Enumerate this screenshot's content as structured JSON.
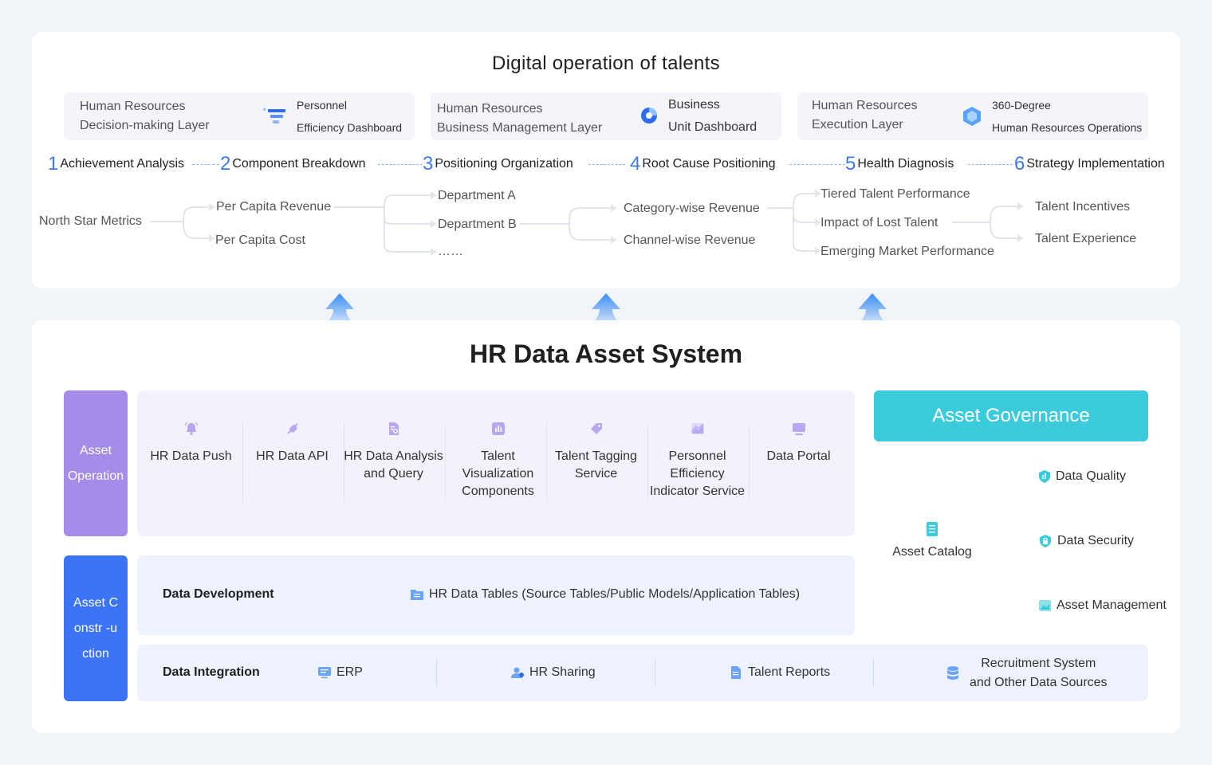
{
  "top": {
    "title": "Digital operation of talents",
    "layers": [
      {
        "line1": "Human Resources",
        "line2": "Decision-making Layer",
        "badge1": "Personnel",
        "badge2": "Efficiency Dashboard",
        "icon": "funnel-icon"
      },
      {
        "line1": "Human Resources",
        "line2": "Business Management Layer",
        "badge1": "Business",
        "badge2": "Unit Dashboard",
        "icon": "pie-chart-icon"
      },
      {
        "line1": "Human Resources",
        "line2": "Execution Layer",
        "badge1": "360-Degree",
        "badge2": "Human Resources Operations",
        "icon": "hexagon-icon"
      }
    ],
    "steps": [
      {
        "num": "1",
        "label": "Achievement Analysis"
      },
      {
        "num": "2",
        "label": "Component Breakdown"
      },
      {
        "num": "3",
        "label": "Positioning Organization"
      },
      {
        "num": "4",
        "label": "Root Cause Positioning"
      },
      {
        "num": "5",
        "label": "Health Diagnosis"
      },
      {
        "num": "6",
        "label": "Strategy Implementation"
      }
    ],
    "tree": {
      "root": "North Star Metrics",
      "level1": [
        "Per Capita Revenue",
        "Per Capita Cost"
      ],
      "level2": [
        "Department A",
        "Department B",
        "……"
      ],
      "level3": [
        "Category-wise Revenue",
        "Channel-wise Revenue"
      ],
      "level4": [
        "Tiered Talent Performance",
        "Impact of Lost Talent",
        "Emerging Market Performance"
      ],
      "level5": [
        "Talent Incentives",
        "Talent Experience"
      ]
    }
  },
  "bottom": {
    "title": "HR Data Asset System",
    "side_operation": "Asset Operation",
    "side_construction": "Asset Constr -uction",
    "operations": [
      {
        "label": "HR Data Push",
        "icon": "bell-icon"
      },
      {
        "label": "HR Data API",
        "icon": "plug-icon"
      },
      {
        "label": "HR Data Analysis and Query",
        "icon": "document-search-icon"
      },
      {
        "label": "Talent Visualization Components",
        "icon": "bar-chart-icon"
      },
      {
        "label": "Talent Tagging Service",
        "icon": "tag-icon"
      },
      {
        "label": "Personnel Efficiency Indicator Service",
        "icon": "line-chart-icon"
      },
      {
        "label": "Data Portal",
        "icon": "monitor-icon"
      }
    ],
    "data_development": {
      "label": "Data Development",
      "tables": "HR Data Tables (Source Tables/Public Models/Application Tables)"
    },
    "data_integration": {
      "label": "Data Integration",
      "sources": [
        {
          "label": "ERP",
          "icon": "monitor-icon"
        },
        {
          "label": "HR Sharing",
          "icon": "users-icon"
        },
        {
          "label": "Talent Reports",
          "icon": "document-icon"
        },
        {
          "label": "Recruitment System and Other Data Sources",
          "line1": "Recruitment System",
          "line2": "and Other Data Sources",
          "icon": "database-icon"
        }
      ]
    },
    "governance": {
      "title": "Asset Governance",
      "catalog": "Asset Catalog",
      "items": [
        "Data Quality",
        "Data Security",
        "Asset Management"
      ]
    }
  },
  "colors": {
    "accent_blue": "#3b7bf0",
    "asset_operation": "#a48ce8",
    "asset_construction": "#3b74f6",
    "governance": "#3ccbdb"
  }
}
